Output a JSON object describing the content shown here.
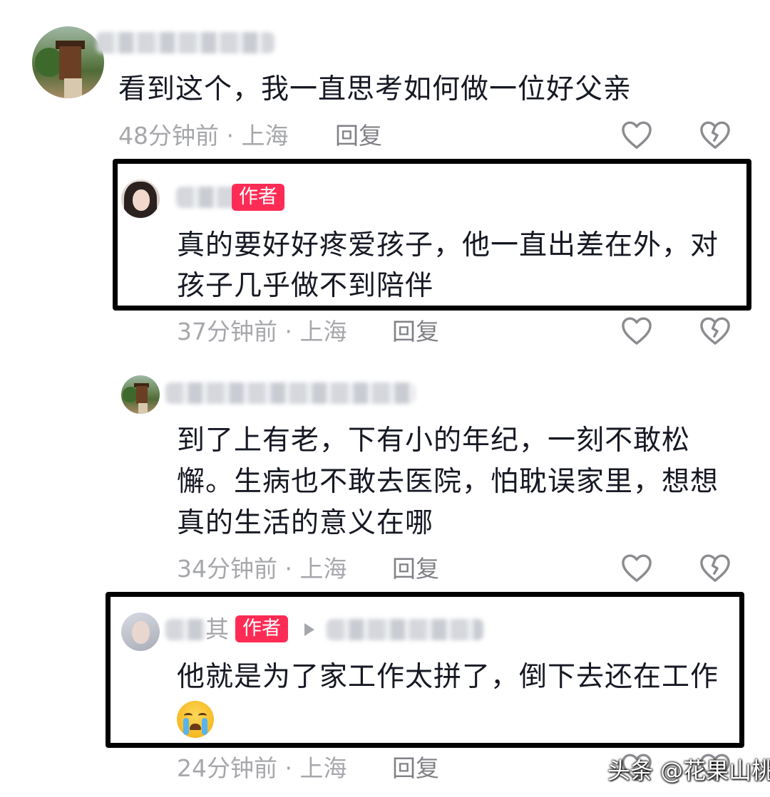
{
  "comments": [
    {
      "text": "看到这个，我一直思考如何做一位好父亲",
      "time": "48分钟前",
      "location": "上海",
      "reply": "回复"
    },
    {
      "badge": "作者",
      "text_lines": [
        "真的要好好疼爱孩子，他一直出差在外，对",
        "孩子几乎做不到陪伴"
      ],
      "time": "37分钟前",
      "location": "上海",
      "reply": "回复"
    },
    {
      "text_lines": [
        "到了上有老，下有小的年纪，一刻不敢松",
        "懈。生病也不敢去医院，怕耽误家里，想想",
        "真的生活的意义在哪"
      ],
      "time": "34分钟前",
      "location": "上海",
      "reply": "回复"
    },
    {
      "name_fragment": "其",
      "badge": "作者",
      "text": "他就是为了家工作太拼了，倒下去还在工作",
      "emoji": "loudly-crying-face",
      "time": "24分钟前",
      "location": "上海",
      "reply": "回复"
    }
  ],
  "separator": "·",
  "watermark": "头条 @花果山桃",
  "colors": {
    "badge": "#fe2c55",
    "meta": "#a6a7ab",
    "text": "#161823",
    "highlight_frame": "#000000"
  }
}
